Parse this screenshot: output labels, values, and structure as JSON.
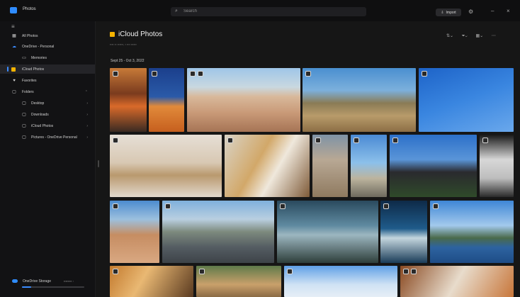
{
  "window": {
    "title": "Photos"
  },
  "search": {
    "placeholder": "Search"
  },
  "titlebar": {
    "import_label": "Import"
  },
  "sidebar": {
    "items": [
      {
        "label": "All Photos",
        "icon": "grid-icon"
      },
      {
        "label": "OneDrive - Personal",
        "icon": "cloud-icon"
      },
      {
        "label": "Memories",
        "icon": "memories-icon"
      },
      {
        "label": "iCloud Photos",
        "icon": "icloud-icon"
      },
      {
        "label": "Favorites",
        "icon": "heart-icon"
      },
      {
        "label": "Folders",
        "icon": "folder-icon"
      },
      {
        "label": "Desktop",
        "icon": "folder-icon"
      },
      {
        "label": "Downloads",
        "icon": "folder-icon"
      },
      {
        "label": "iCloud Photos",
        "icon": "folder-icon"
      },
      {
        "label": "Pictures - OneDrive Personal",
        "icon": "folder-icon"
      }
    ],
    "storage": {
      "label": "OneDrive Storage",
      "usage_fraction": 0.15
    }
  },
  "main": {
    "title": "iCloud Photos",
    "date_range": "Sept 25 - Oct 3, 2022"
  },
  "colors": {
    "accent": "#3b8cff",
    "icloud_badge": "#f5b300"
  }
}
